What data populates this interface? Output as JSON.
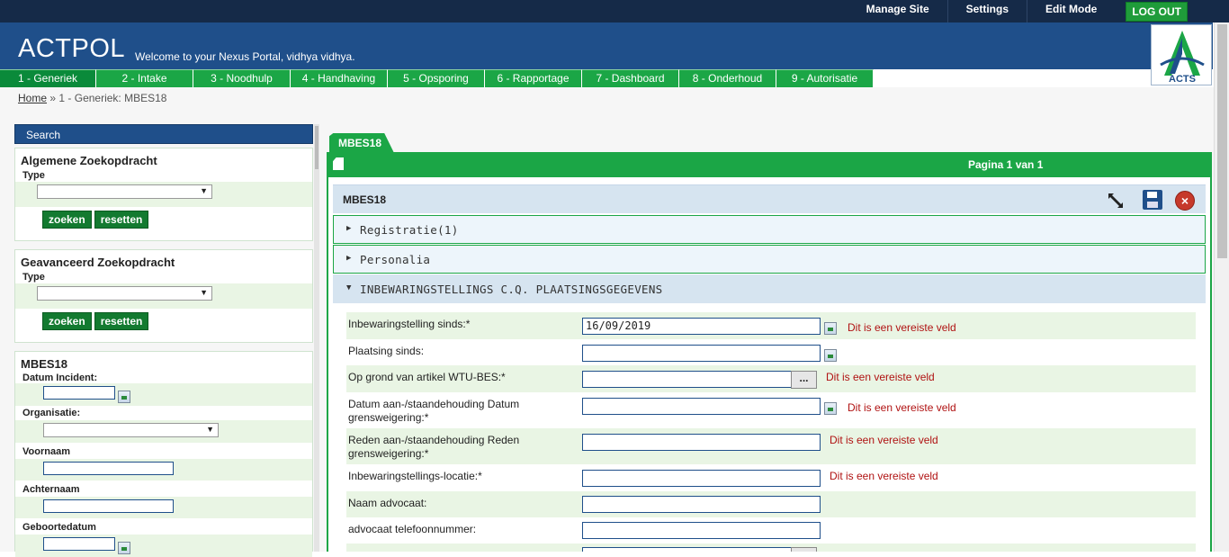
{
  "topnav": {
    "links": [
      "Manage Site",
      "Settings",
      "Edit Mode"
    ],
    "logout": "LOG OUT"
  },
  "brand": "ACTPOL",
  "welcome": "Welcome to your Nexus Portal, vidhya vidhya.",
  "logo_text": "ACTS",
  "tabs": [
    "1 - Generiek",
    "2 - Intake",
    "3 - Noodhulp",
    "4 - Handhaving",
    "5 - Opsporing",
    "6 - Rapportage",
    "7 - Dashboard",
    "8 - Onderhoud",
    "9 - Autorisatie"
  ],
  "breadcrumb": {
    "home": "Home",
    "sep": "»",
    "current": "1 - Generiek: MBES18"
  },
  "left": {
    "search_title": "Search",
    "general": {
      "title": "Algemene Zoekopdracht",
      "type_label": "Type",
      "search": "zoeken",
      "reset": "resetten"
    },
    "advanced": {
      "title": "Geavanceerd Zoekopdracht",
      "type_label": "Type",
      "search": "zoeken",
      "reset": "resetten"
    },
    "mbes": {
      "title": "MBES18",
      "fields": [
        "Datum Incident:",
        "Organisatie:",
        "Voornaam",
        "Achternaam",
        "Geboortedatum"
      ]
    }
  },
  "main": {
    "tab": "MBES18",
    "pagination": "Pagina 1 van 1",
    "panel_title": "MBES18",
    "sections": [
      "Registratie(1)",
      "Personalia",
      "INBEWARINGSTELLINGS C.Q. PLAATSINGSGEGEVENS"
    ],
    "required_msg": "Dit is een vereiste veld",
    "fields": [
      {
        "label": "Inbewaringstelling sinds:*",
        "value": "16/09/2019"
      },
      {
        "label": "Plaatsing sinds:",
        "value": ""
      },
      {
        "label": "Op grond van artikel WTU-BES:*",
        "value": ""
      },
      {
        "label": "Datum aan-/staandehouding Datum grensweigering:*",
        "value": ""
      },
      {
        "label": "Reden aan-/staandehouding Reden grensweigering:*",
        "value": ""
      },
      {
        "label": "Inbewaringstellings-locatie:*",
        "value": ""
      },
      {
        "label": "Naam advocaat:",
        "value": ""
      },
      {
        "label": "advocaat telefoonnummer:",
        "value": ""
      }
    ],
    "lookup_btn": "..."
  },
  "colors": {
    "navy": "#152a48",
    "blue": "#1f4f8a",
    "green": "#1ba646",
    "error": "#b01212"
  }
}
